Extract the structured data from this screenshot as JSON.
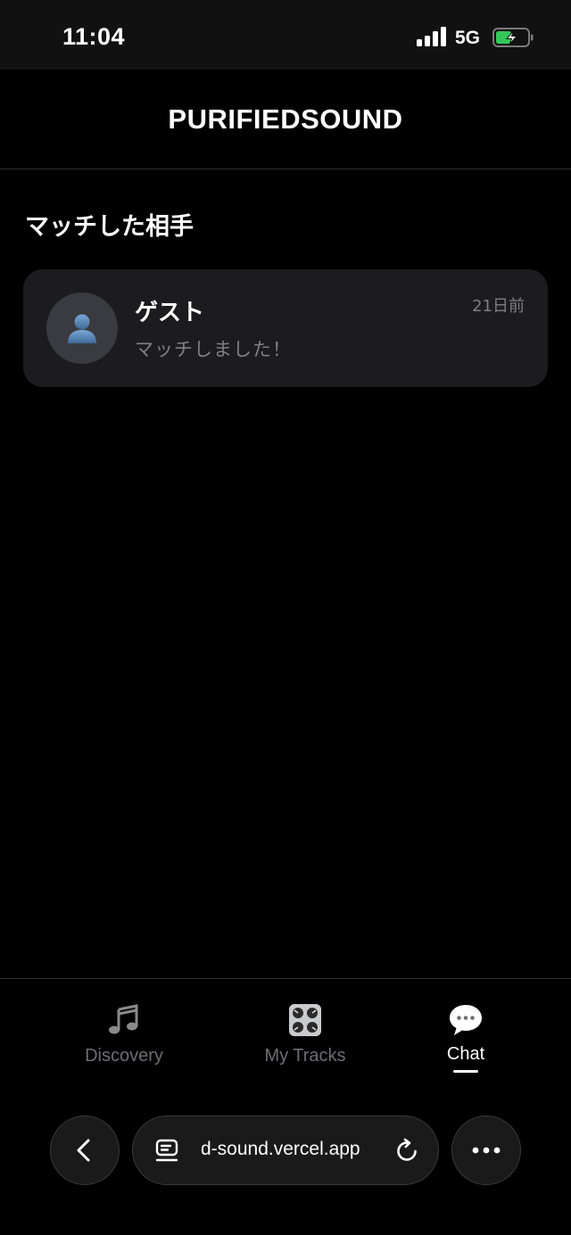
{
  "status_bar": {
    "time": "11:04",
    "network": "5G",
    "icons": [
      "signal-icon",
      "battery-charging-icon"
    ]
  },
  "header": {
    "title": "PURIFIEDSOUND"
  },
  "matches_section": {
    "title": "マッチした相手",
    "items": [
      {
        "name": "ゲスト",
        "message": "マッチしました！",
        "time": "21日前",
        "avatar_icon": "user-silhouette-icon"
      }
    ]
  },
  "bottom_nav": {
    "items": [
      {
        "label": "Discovery",
        "icon": "music-note-icon",
        "active": false
      },
      {
        "label": "My Tracks",
        "icon": "control-knobs-icon",
        "active": false
      },
      {
        "label": "Chat",
        "icon": "speech-bubble-icon",
        "active": true
      }
    ]
  },
  "browser": {
    "url": "d-sound.vercel.app",
    "icons": [
      "back-icon",
      "tab-list-icon",
      "reload-icon",
      "more-icon"
    ]
  },
  "colors": {
    "background": "#000000",
    "card": "#1c1c1e",
    "muted_text": "#7f7f84",
    "charging_green": "#34c759"
  }
}
